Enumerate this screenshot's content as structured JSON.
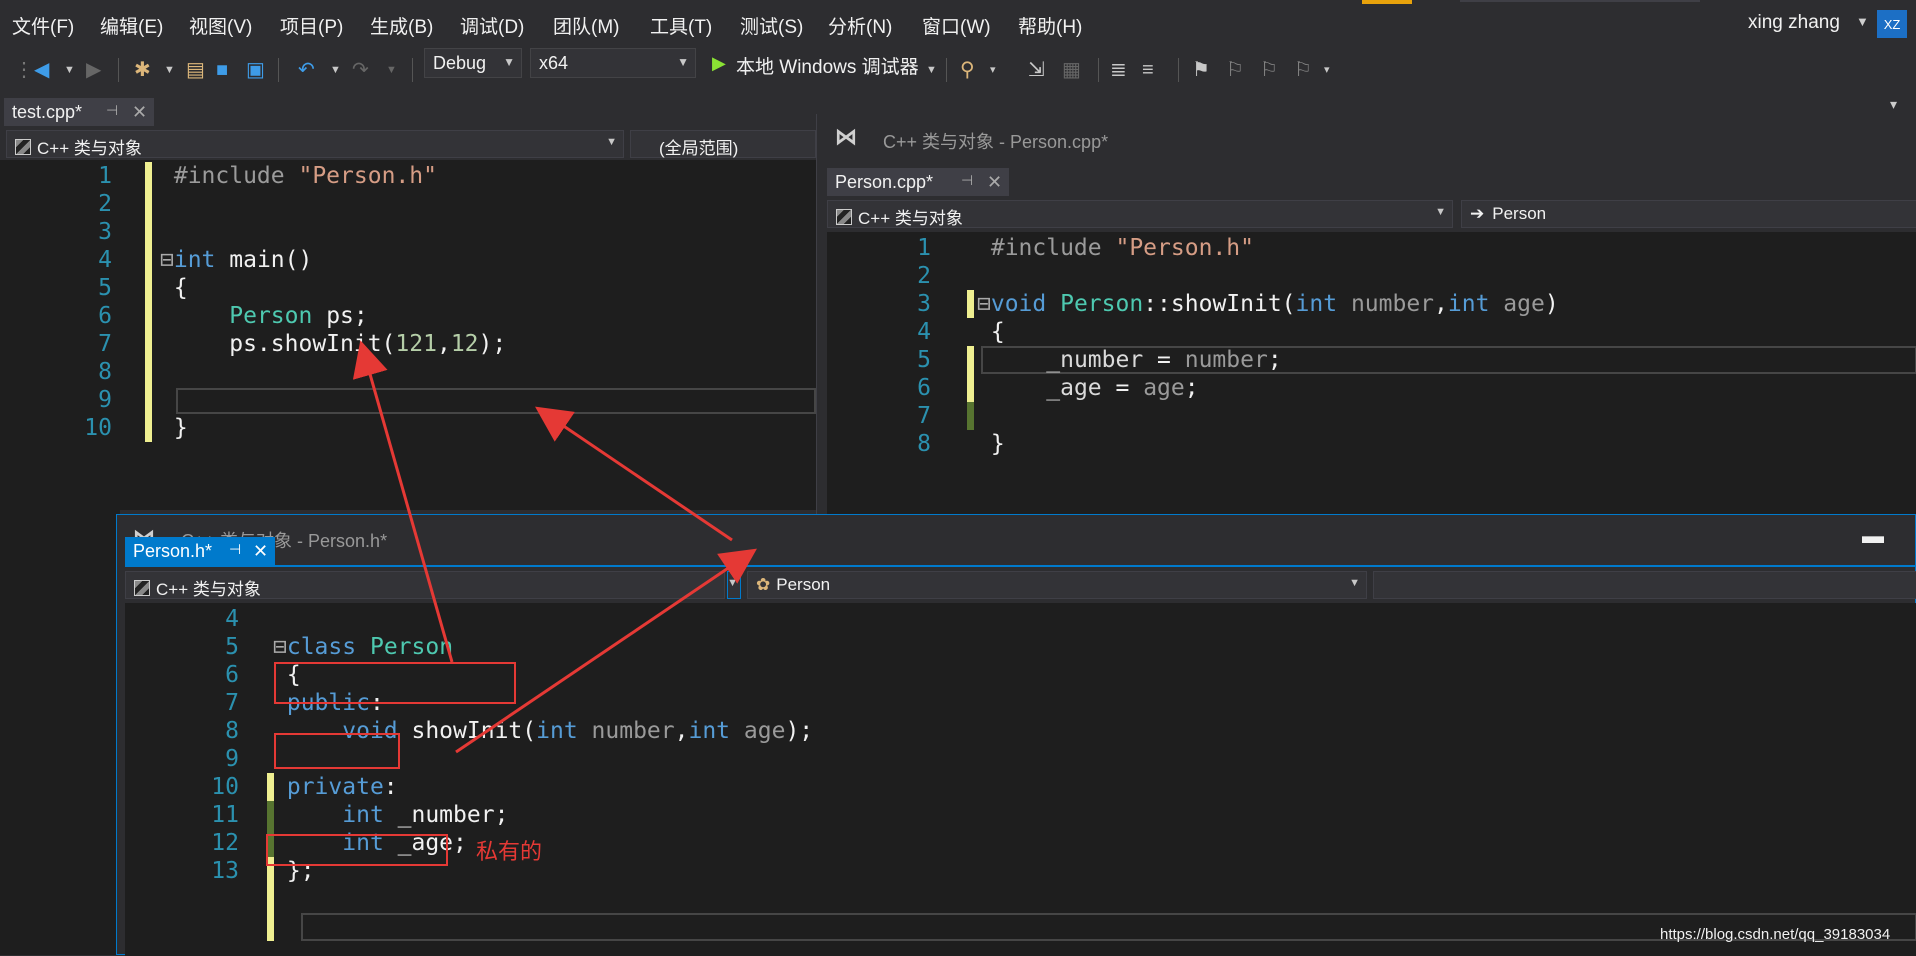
{
  "menu": [
    "文件(F)",
    "编辑(E)",
    "视图(V)",
    "项目(P)",
    "生成(B)",
    "调试(D)",
    "团队(M)",
    "工具(T)",
    "测试(S)",
    "分析(N)",
    "窗口(W)",
    "帮助(H)"
  ],
  "user": {
    "name": "xing zhang",
    "initials": "XZ"
  },
  "toolbar": {
    "config": "Debug",
    "platform": "x64",
    "run_label": "本地 Windows 调试器"
  },
  "test_pane": {
    "tab": "test.cpp*",
    "nav_project": "C++ 类与对象",
    "nav_scope": "(全局范围)",
    "line_numbers": [
      "1",
      "2",
      "3",
      "4",
      "5",
      "6",
      "7",
      "8",
      "9",
      "10"
    ]
  },
  "person_cpp_pane": {
    "window_title": "C++ 类与对象 - Person.cpp*",
    "tab": "Person.cpp*",
    "nav_project": "C++ 类与对象",
    "nav_scope": "Person",
    "line_numbers": [
      "1",
      "2",
      "3",
      "4",
      "5",
      "6",
      "7",
      "8"
    ]
  },
  "person_h_pane": {
    "window_title": "C++ 类与对象 - Person.h*",
    "tab": "Person.h*",
    "nav_project": "C++ 类与对象",
    "nav_scope": "Person",
    "line_numbers": [
      "4",
      "5",
      "6",
      "7",
      "8",
      "9",
      "10",
      "11",
      "12",
      "13"
    ]
  },
  "annotation": {
    "private_note": "私有的"
  },
  "watermark": "https://blog.csdn.net/qq_39183034"
}
